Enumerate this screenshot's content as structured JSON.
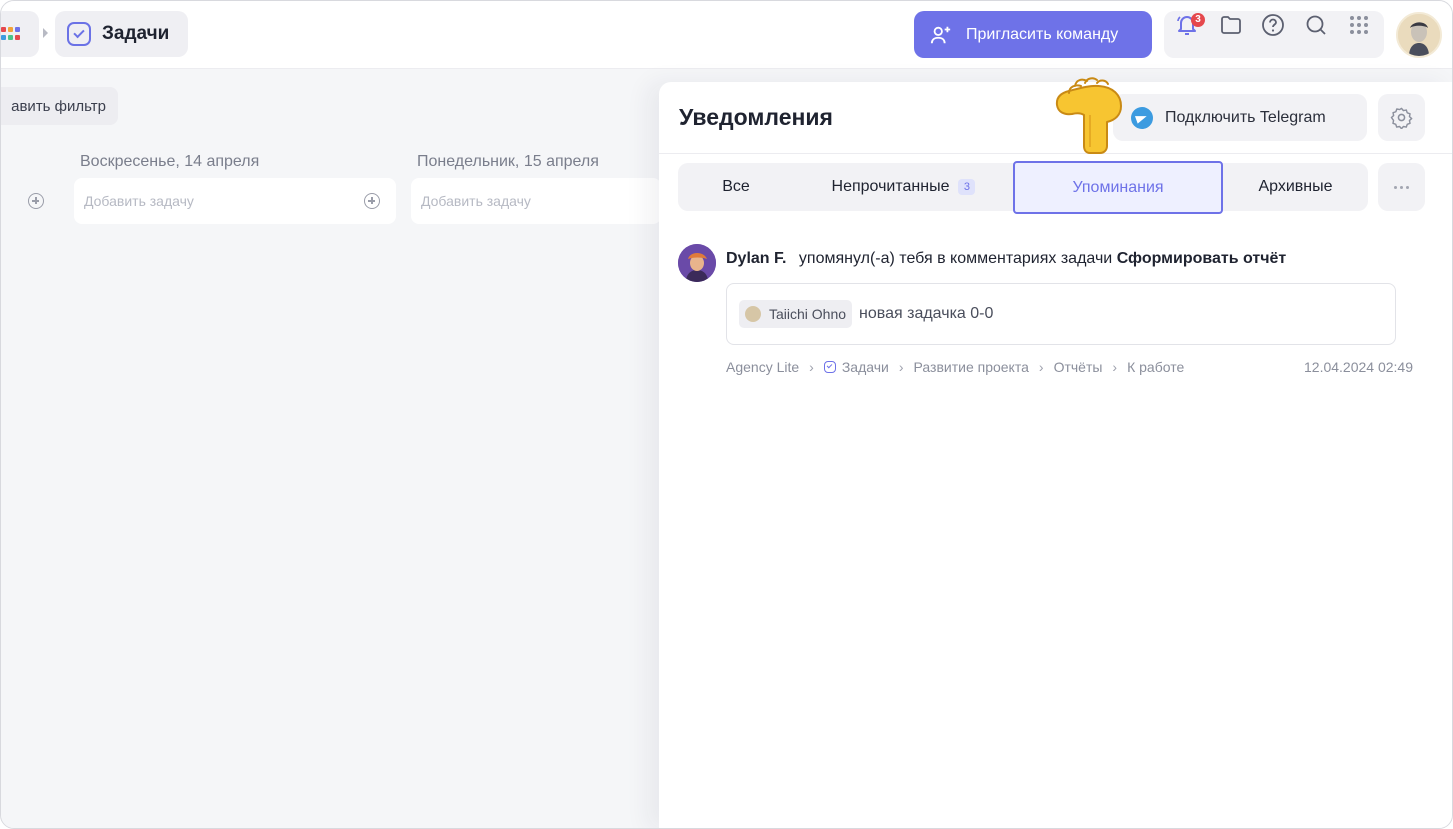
{
  "app": {
    "title": "Задачи"
  },
  "header": {
    "invite_label": "Пригласить команду",
    "notifications_count": "3"
  },
  "board": {
    "filter_label": "авить фильтр",
    "days": [
      {
        "title": "Воскресенье, 14 апреля",
        "add_task_placeholder": "Добавить задачу"
      },
      {
        "title": "Понедельник, 15 апреля",
        "add_task_placeholder": "Добавить задачу"
      }
    ]
  },
  "panel": {
    "title": "Уведомления",
    "telegram_label": "Подключить Telegram",
    "tabs": [
      {
        "label": "Все"
      },
      {
        "label": "Непрочитанные",
        "count": "3"
      },
      {
        "label": "Упоминания",
        "active": true
      },
      {
        "label": "Архивные"
      }
    ],
    "notification": {
      "author": "Dylan F.",
      "action": "упомянул(-а) тебя в комментариях задачи",
      "task_name": "Сформировать отчёт",
      "mention": "Taiichi Ohno",
      "comment": "новая задачка 0-0",
      "path": [
        "Agency Lite",
        "Задачи",
        "Развитие проекта",
        "Отчёты",
        "К работе"
      ],
      "timestamp": "12.04.2024 02:49"
    }
  },
  "colors": {
    "accent": "#6e72e8",
    "badge": "#e5484d",
    "telegram": "#3c9be0"
  },
  "icons": [
    "apps-grid-icon",
    "check-icon",
    "add-user-icon",
    "bell-icon",
    "folder-icon",
    "help-icon",
    "search-icon",
    "grid-icon",
    "telegram-icon",
    "gear-icon",
    "more-icon",
    "plus-circle-icon",
    "pointing-hand-icon"
  ]
}
